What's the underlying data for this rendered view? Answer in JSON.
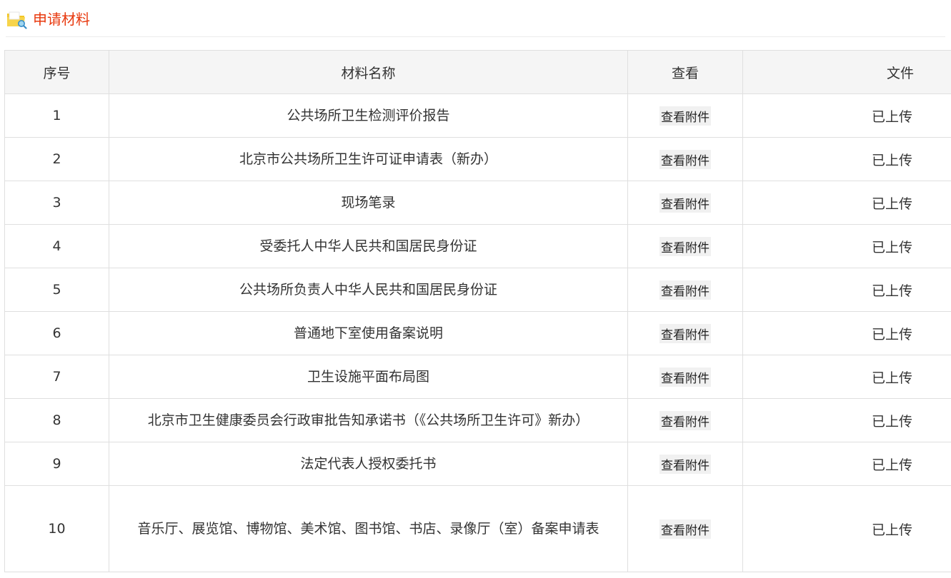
{
  "section": {
    "title": "申请材料",
    "icon": "folder-search-icon"
  },
  "table": {
    "headers": {
      "index": "序号",
      "name": "材料名称",
      "view": "查看",
      "file": "文件"
    },
    "rows": [
      {
        "index": "1",
        "name": "公共场所卫生检测评价报告",
        "view": "查看附件",
        "file": "已上传"
      },
      {
        "index": "2",
        "name": "北京市公共场所卫生许可证申请表（新办）",
        "view": "查看附件",
        "file": "已上传"
      },
      {
        "index": "3",
        "name": "现场笔录",
        "view": "查看附件",
        "file": "已上传"
      },
      {
        "index": "4",
        "name": "受委托人中华人民共和国居民身份证",
        "view": "查看附件",
        "file": "已上传"
      },
      {
        "index": "5",
        "name": "公共场所负责人中华人民共和国居民身份证",
        "view": "查看附件",
        "file": "已上传"
      },
      {
        "index": "6",
        "name": "普通地下室使用备案说明",
        "view": "查看附件",
        "file": "已上传"
      },
      {
        "index": "7",
        "name": "卫生设施平面布局图",
        "view": "查看附件",
        "file": "已上传"
      },
      {
        "index": "8",
        "name": "北京市卫生健康委员会行政审批告知承诺书（《公共场所卫生许可》新办）",
        "view": "查看附件",
        "file": "已上传"
      },
      {
        "index": "9",
        "name": "法定代表人授权委托书",
        "view": "查看附件",
        "file": "已上传"
      },
      {
        "index": "10",
        "name": "音乐厅、展览馆、博物馆、美术馆、图书馆、书店、录像厅（室）备案申请表",
        "view": "查看附件",
        "file": "已上传"
      }
    ]
  },
  "colors": {
    "title": "#e8380d",
    "header_bg": "#f5f5f5",
    "border": "#dfdfdf"
  }
}
